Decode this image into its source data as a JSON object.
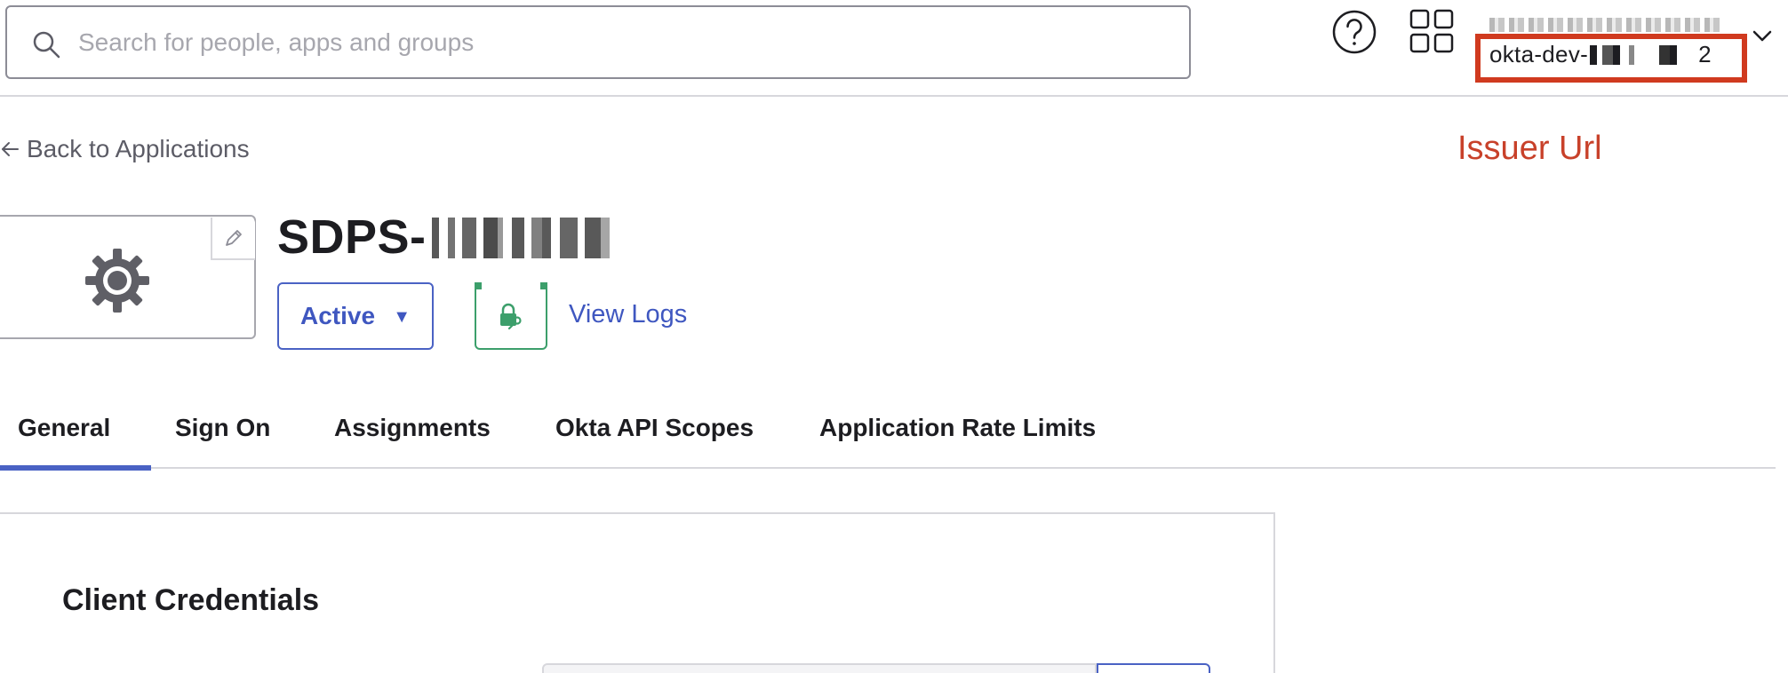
{
  "search": {
    "placeholder": "Search for people, apps and groups",
    "value": ""
  },
  "account": {
    "name": "",
    "org_prefix": "okta-dev-",
    "org_suffix": "2"
  },
  "annotation": {
    "label": "Issuer Url",
    "color": "#c8412a"
  },
  "navigation": {
    "back_label": "Back to Applications"
  },
  "app": {
    "title_prefix": "SDPS-",
    "status_label": "Active",
    "view_logs_label": "View Logs"
  },
  "tabs": [
    {
      "label": "General",
      "active": true
    },
    {
      "label": "Sign On",
      "active": false
    },
    {
      "label": "Assignments",
      "active": false
    },
    {
      "label": "Okta API Scopes",
      "active": false
    },
    {
      "label": "Application Rate Limits",
      "active": false
    }
  ],
  "card": {
    "title": "Client Credentials"
  },
  "icons": {
    "search": "search-icon",
    "help": "help-icon",
    "apps": "apps-grid-icon",
    "account_menu": "chevron-down-icon",
    "back": "arrow-left-icon",
    "logo": "gear-icon",
    "edit": "pencil-icon",
    "push_groups": "lock-key-icon"
  },
  "colors": {
    "accent": "#4a62c4",
    "success": "#3c9f6b",
    "highlight": "#d03a1f"
  }
}
